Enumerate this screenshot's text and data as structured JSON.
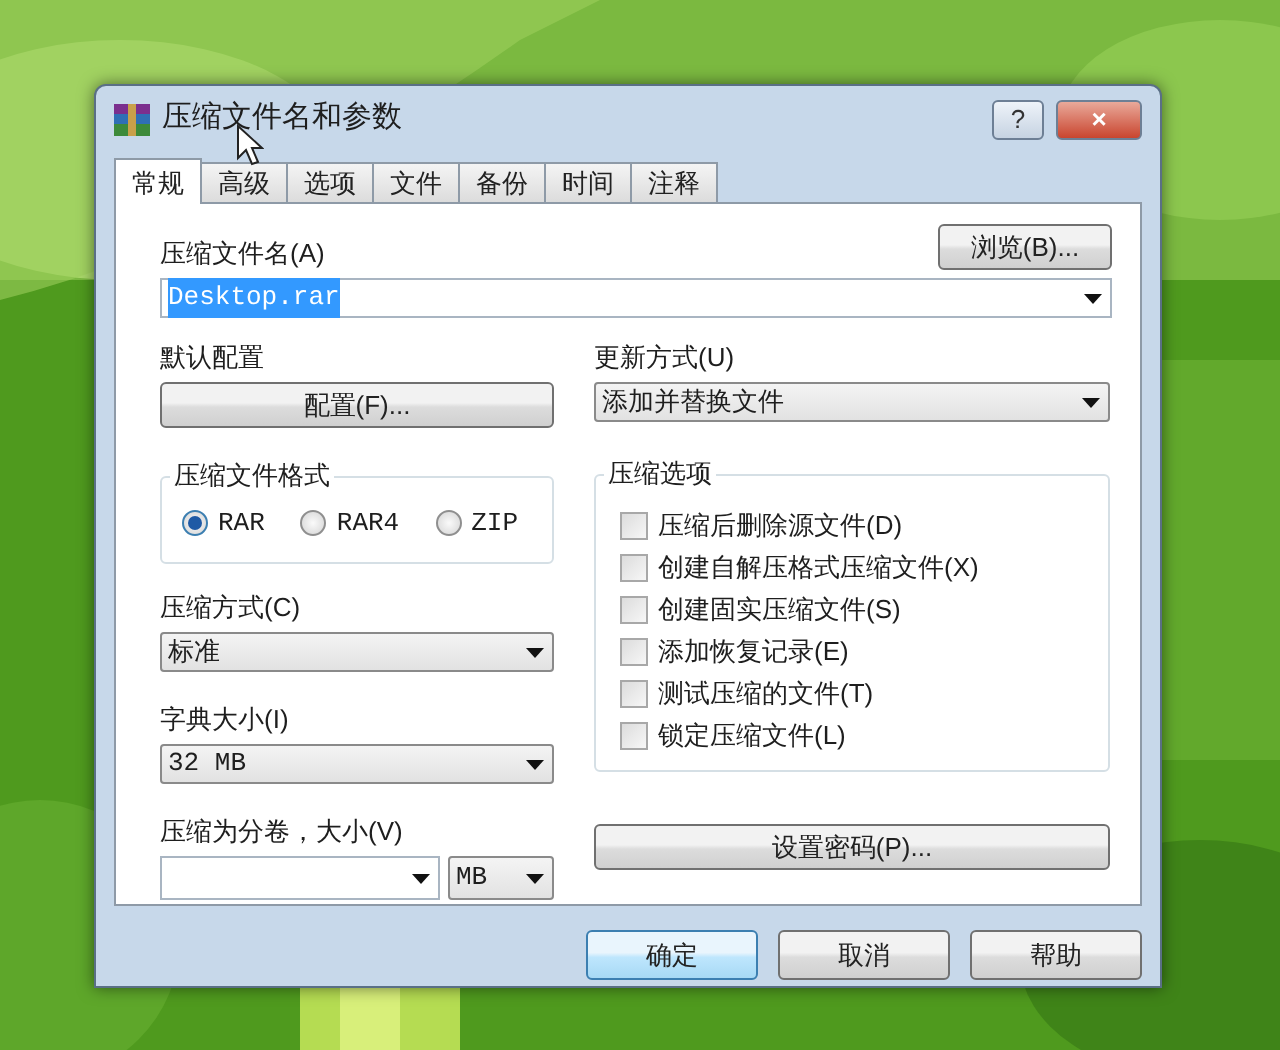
{
  "window": {
    "title": "压缩文件名和参数",
    "help_button": "?",
    "close_button": "×"
  },
  "tabs": [
    {
      "label": "常规",
      "selected": true
    },
    {
      "label": "高级",
      "selected": false
    },
    {
      "label": "选项",
      "selected": false
    },
    {
      "label": "文件",
      "selected": false
    },
    {
      "label": "备份",
      "selected": false
    },
    {
      "label": "时间",
      "selected": false
    },
    {
      "label": "注释",
      "selected": false
    }
  ],
  "archive_name": {
    "label": "压缩文件名(A)",
    "value": "Desktop.rar",
    "text_selected": true,
    "browse_button": "浏览(B)..."
  },
  "profiles": {
    "label": "默认配置",
    "button": "配置(F)..."
  },
  "update_mode": {
    "label": "更新方式(U)",
    "value": "添加并替换文件"
  },
  "archive_format": {
    "label": "压缩文件格式",
    "options": [
      {
        "label": "RAR",
        "selected": true
      },
      {
        "label": "RAR4",
        "selected": false
      },
      {
        "label": "ZIP",
        "selected": false
      }
    ]
  },
  "compression_method": {
    "label": "压缩方式(C)",
    "value": "标准"
  },
  "dictionary_size": {
    "label": "字典大小(I)",
    "value": "32 MB"
  },
  "split_volumes": {
    "label": "压缩为分卷，大小(V)",
    "unit": "MB"
  },
  "archiving_options": {
    "label": "压缩选项",
    "items": [
      {
        "label": "压缩后删除源文件(D)",
        "checked": false
      },
      {
        "label": "创建自解压格式压缩文件(X)",
        "checked": false
      },
      {
        "label": "创建固实压缩文件(S)",
        "checked": false
      },
      {
        "label": "添加恢复记录(E)",
        "checked": false
      },
      {
        "label": "测试压缩的文件(T)",
        "checked": false
      },
      {
        "label": "锁定压缩文件(L)",
        "checked": false
      }
    ]
  },
  "password_button": "设置密码(P)...",
  "buttons": [
    {
      "label": "确定",
      "default": true
    },
    {
      "label": "取消",
      "default": false
    },
    {
      "label": "帮助",
      "default": false
    }
  ]
}
